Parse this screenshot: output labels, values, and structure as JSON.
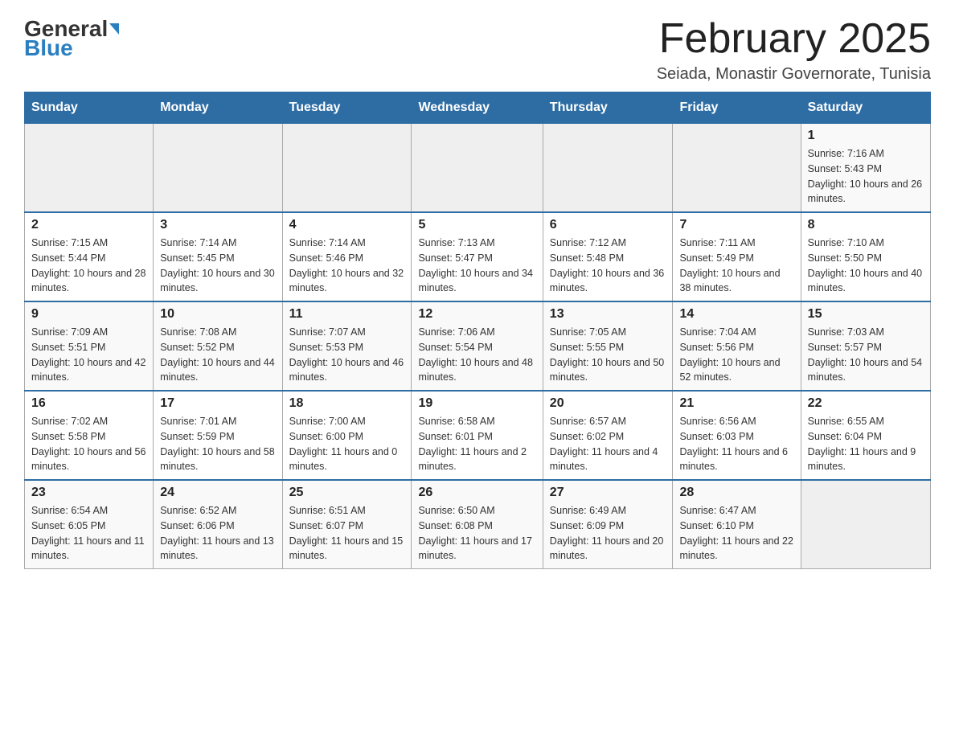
{
  "header": {
    "logo_general": "General",
    "logo_blue": "Blue",
    "month_title": "February 2025",
    "location": "Seiada, Monastir Governorate, Tunisia"
  },
  "days_of_week": [
    "Sunday",
    "Monday",
    "Tuesday",
    "Wednesday",
    "Thursday",
    "Friday",
    "Saturday"
  ],
  "weeks": [
    [
      {
        "day": "",
        "sunrise": "",
        "sunset": "",
        "daylight": "",
        "empty": true
      },
      {
        "day": "",
        "sunrise": "",
        "sunset": "",
        "daylight": "",
        "empty": true
      },
      {
        "day": "",
        "sunrise": "",
        "sunset": "",
        "daylight": "",
        "empty": true
      },
      {
        "day": "",
        "sunrise": "",
        "sunset": "",
        "daylight": "",
        "empty": true
      },
      {
        "day": "",
        "sunrise": "",
        "sunset": "",
        "daylight": "",
        "empty": true
      },
      {
        "day": "",
        "sunrise": "",
        "sunset": "",
        "daylight": "",
        "empty": true
      },
      {
        "day": "1",
        "sunrise": "Sunrise: 7:16 AM",
        "sunset": "Sunset: 5:43 PM",
        "daylight": "Daylight: 10 hours and 26 minutes.",
        "empty": false
      }
    ],
    [
      {
        "day": "2",
        "sunrise": "Sunrise: 7:15 AM",
        "sunset": "Sunset: 5:44 PM",
        "daylight": "Daylight: 10 hours and 28 minutes.",
        "empty": false
      },
      {
        "day": "3",
        "sunrise": "Sunrise: 7:14 AM",
        "sunset": "Sunset: 5:45 PM",
        "daylight": "Daylight: 10 hours and 30 minutes.",
        "empty": false
      },
      {
        "day": "4",
        "sunrise": "Sunrise: 7:14 AM",
        "sunset": "Sunset: 5:46 PM",
        "daylight": "Daylight: 10 hours and 32 minutes.",
        "empty": false
      },
      {
        "day": "5",
        "sunrise": "Sunrise: 7:13 AM",
        "sunset": "Sunset: 5:47 PM",
        "daylight": "Daylight: 10 hours and 34 minutes.",
        "empty": false
      },
      {
        "day": "6",
        "sunrise": "Sunrise: 7:12 AM",
        "sunset": "Sunset: 5:48 PM",
        "daylight": "Daylight: 10 hours and 36 minutes.",
        "empty": false
      },
      {
        "day": "7",
        "sunrise": "Sunrise: 7:11 AM",
        "sunset": "Sunset: 5:49 PM",
        "daylight": "Daylight: 10 hours and 38 minutes.",
        "empty": false
      },
      {
        "day": "8",
        "sunrise": "Sunrise: 7:10 AM",
        "sunset": "Sunset: 5:50 PM",
        "daylight": "Daylight: 10 hours and 40 minutes.",
        "empty": false
      }
    ],
    [
      {
        "day": "9",
        "sunrise": "Sunrise: 7:09 AM",
        "sunset": "Sunset: 5:51 PM",
        "daylight": "Daylight: 10 hours and 42 minutes.",
        "empty": false
      },
      {
        "day": "10",
        "sunrise": "Sunrise: 7:08 AM",
        "sunset": "Sunset: 5:52 PM",
        "daylight": "Daylight: 10 hours and 44 minutes.",
        "empty": false
      },
      {
        "day": "11",
        "sunrise": "Sunrise: 7:07 AM",
        "sunset": "Sunset: 5:53 PM",
        "daylight": "Daylight: 10 hours and 46 minutes.",
        "empty": false
      },
      {
        "day": "12",
        "sunrise": "Sunrise: 7:06 AM",
        "sunset": "Sunset: 5:54 PM",
        "daylight": "Daylight: 10 hours and 48 minutes.",
        "empty": false
      },
      {
        "day": "13",
        "sunrise": "Sunrise: 7:05 AM",
        "sunset": "Sunset: 5:55 PM",
        "daylight": "Daylight: 10 hours and 50 minutes.",
        "empty": false
      },
      {
        "day": "14",
        "sunrise": "Sunrise: 7:04 AM",
        "sunset": "Sunset: 5:56 PM",
        "daylight": "Daylight: 10 hours and 52 minutes.",
        "empty": false
      },
      {
        "day": "15",
        "sunrise": "Sunrise: 7:03 AM",
        "sunset": "Sunset: 5:57 PM",
        "daylight": "Daylight: 10 hours and 54 minutes.",
        "empty": false
      }
    ],
    [
      {
        "day": "16",
        "sunrise": "Sunrise: 7:02 AM",
        "sunset": "Sunset: 5:58 PM",
        "daylight": "Daylight: 10 hours and 56 minutes.",
        "empty": false
      },
      {
        "day": "17",
        "sunrise": "Sunrise: 7:01 AM",
        "sunset": "Sunset: 5:59 PM",
        "daylight": "Daylight: 10 hours and 58 minutes.",
        "empty": false
      },
      {
        "day": "18",
        "sunrise": "Sunrise: 7:00 AM",
        "sunset": "Sunset: 6:00 PM",
        "daylight": "Daylight: 11 hours and 0 minutes.",
        "empty": false
      },
      {
        "day": "19",
        "sunrise": "Sunrise: 6:58 AM",
        "sunset": "Sunset: 6:01 PM",
        "daylight": "Daylight: 11 hours and 2 minutes.",
        "empty": false
      },
      {
        "day": "20",
        "sunrise": "Sunrise: 6:57 AM",
        "sunset": "Sunset: 6:02 PM",
        "daylight": "Daylight: 11 hours and 4 minutes.",
        "empty": false
      },
      {
        "day": "21",
        "sunrise": "Sunrise: 6:56 AM",
        "sunset": "Sunset: 6:03 PM",
        "daylight": "Daylight: 11 hours and 6 minutes.",
        "empty": false
      },
      {
        "day": "22",
        "sunrise": "Sunrise: 6:55 AM",
        "sunset": "Sunset: 6:04 PM",
        "daylight": "Daylight: 11 hours and 9 minutes.",
        "empty": false
      }
    ],
    [
      {
        "day": "23",
        "sunrise": "Sunrise: 6:54 AM",
        "sunset": "Sunset: 6:05 PM",
        "daylight": "Daylight: 11 hours and 11 minutes.",
        "empty": false
      },
      {
        "day": "24",
        "sunrise": "Sunrise: 6:52 AM",
        "sunset": "Sunset: 6:06 PM",
        "daylight": "Daylight: 11 hours and 13 minutes.",
        "empty": false
      },
      {
        "day": "25",
        "sunrise": "Sunrise: 6:51 AM",
        "sunset": "Sunset: 6:07 PM",
        "daylight": "Daylight: 11 hours and 15 minutes.",
        "empty": false
      },
      {
        "day": "26",
        "sunrise": "Sunrise: 6:50 AM",
        "sunset": "Sunset: 6:08 PM",
        "daylight": "Daylight: 11 hours and 17 minutes.",
        "empty": false
      },
      {
        "day": "27",
        "sunrise": "Sunrise: 6:49 AM",
        "sunset": "Sunset: 6:09 PM",
        "daylight": "Daylight: 11 hours and 20 minutes.",
        "empty": false
      },
      {
        "day": "28",
        "sunrise": "Sunrise: 6:47 AM",
        "sunset": "Sunset: 6:10 PM",
        "daylight": "Daylight: 11 hours and 22 minutes.",
        "empty": false
      },
      {
        "day": "",
        "sunrise": "",
        "sunset": "",
        "daylight": "",
        "empty": true
      }
    ]
  ]
}
